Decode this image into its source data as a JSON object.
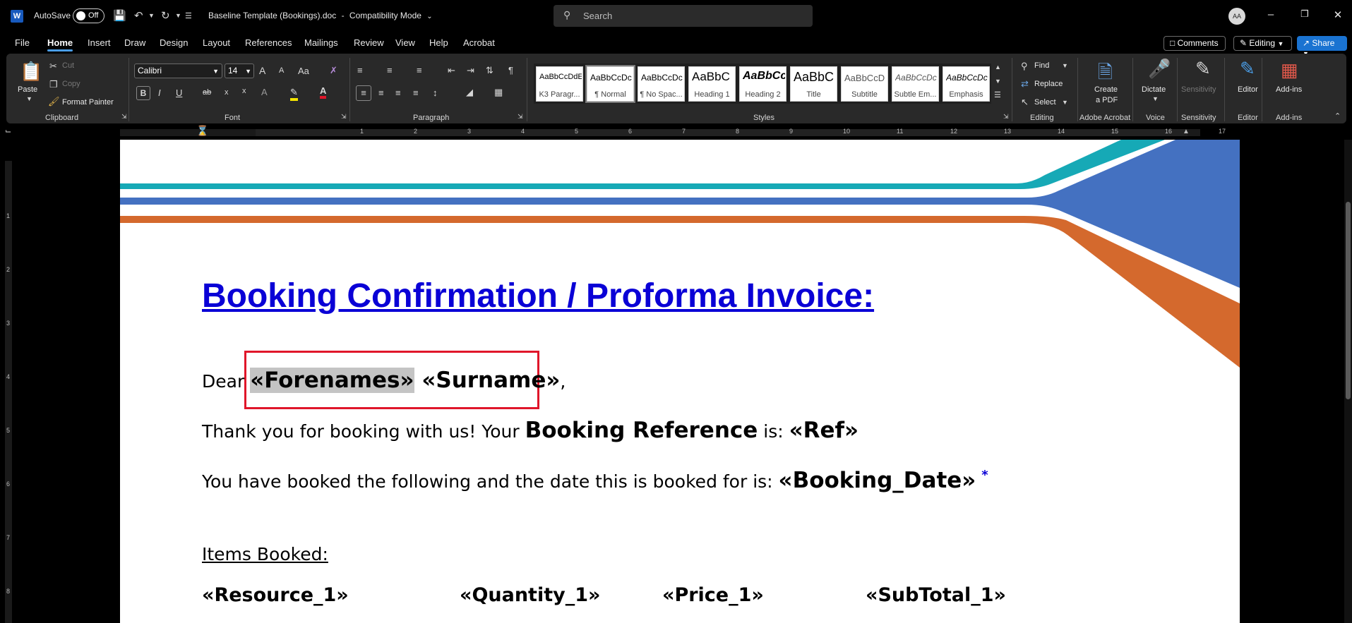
{
  "titlebar": {
    "app_icon": "W",
    "autosave_label": "AutoSave",
    "autosave_state": "Off",
    "document_title": "Baseline Template (Bookings).doc",
    "mode_separator": "-",
    "mode": "Compatibility Mode",
    "search_placeholder": "Search",
    "avatar_initials": "AA"
  },
  "tabs": [
    "File",
    "Home",
    "Insert",
    "Draw",
    "Design",
    "Layout",
    "References",
    "Mailings",
    "Review",
    "View",
    "Help",
    "Acrobat"
  ],
  "active_tab": "Home",
  "top_right": {
    "comments_label": "Comments",
    "editing_label": "Editing",
    "share_label": "Share"
  },
  "ribbon": {
    "clipboard": {
      "label": "Clipboard",
      "paste": "Paste",
      "cut": "Cut",
      "copy": "Copy",
      "format_painter": "Format Painter"
    },
    "font": {
      "label": "Font",
      "font_name": "Calibri",
      "font_size": "14",
      "grow": "A",
      "shrink": "A",
      "change_case": "Aa",
      "bold": "B",
      "italic": "I",
      "underline": "U",
      "strikethrough": "ab",
      "subscript": "x",
      "superscript": "x",
      "text_effects": "A",
      "font_color": "A"
    },
    "paragraph": {
      "label": "Paragraph"
    },
    "styles": {
      "label": "Styles",
      "items": [
        {
          "preview": "AaBbCcDdE",
          "name": "K3 Paragr..."
        },
        {
          "preview": "AaBbCcDc",
          "name": "¶ Normal"
        },
        {
          "preview": "AaBbCcDc",
          "name": "¶ No Spac..."
        },
        {
          "preview": "AaBbC",
          "name": "Heading 1"
        },
        {
          "preview": "AaBbCc",
          "name": "Heading 2"
        },
        {
          "preview": "AaBbC",
          "name": "Title"
        },
        {
          "preview": "AaBbCcD",
          "name": "Subtitle"
        },
        {
          "preview": "AaBbCcDc",
          "name": "Subtle Em..."
        },
        {
          "preview": "AaBbCcDc",
          "name": "Emphasis"
        }
      ]
    },
    "editing": {
      "label": "Editing",
      "find": "Find",
      "replace": "Replace",
      "select": "Select"
    },
    "acrobat": {
      "label": "Adobe Acrobat",
      "create_pdf_line1": "Create",
      "create_pdf_line2": "a PDF"
    },
    "voice": {
      "label": "Voice",
      "dictate": "Dictate"
    },
    "sensitivity": {
      "label": "Sensitivity",
      "button": "Sensitivity"
    },
    "editor": {
      "label": "Editor",
      "button": "Editor"
    },
    "addins": {
      "label": "Add-ins",
      "button": "Add-ins"
    }
  },
  "ruler_numbers": [
    "1",
    "2",
    "3",
    "4",
    "5",
    "6",
    "7",
    "8",
    "9",
    "10",
    "11",
    "12",
    "13",
    "14",
    "15",
    "16",
    "17"
  ],
  "vruler_numbers": [
    "1",
    "2",
    "3",
    "4",
    "5",
    "6",
    "7",
    "8"
  ],
  "document": {
    "heading": "Booking Confirmation / Proforma Invoice:",
    "dear": "Dear ",
    "forenames_field": "«Forenames»",
    "surname_field": "«Surname»",
    "dear_end": ",",
    "thanks_prefix": "Thank you for booking with us! Your ",
    "booking_reference": "Booking Reference",
    "thanks_mid": " is: ",
    "ref_field": "«Ref»",
    "booked_prefix": "You have booked the following and the date this is booked for is: ",
    "booking_date_field": "«Booking_Date»",
    "asterisk": "*",
    "items_booked": "Items Booked:",
    "row_fields": [
      "«Resource_1»",
      "«Quantity_1»",
      "«Price_1»",
      "«SubTotal_1»"
    ]
  },
  "colors": {
    "heading_blue": "#0a00d6",
    "teal_stripe": "#16a9b6",
    "blue_stripe": "#4471c1",
    "orange_stripe": "#d4692d",
    "highlight_box": "#e0162a",
    "accent": "#1a73d1"
  }
}
